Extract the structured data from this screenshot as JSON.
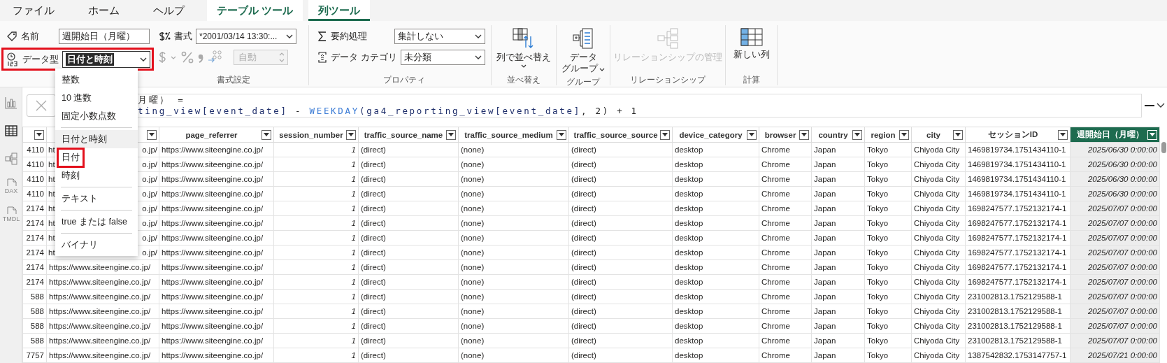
{
  "tabs": [
    {
      "label": "ファイル",
      "kind": "main",
      "selected": false
    },
    {
      "label": "ホーム",
      "kind": "main",
      "selected": false
    },
    {
      "label": "ヘルプ",
      "kind": "main",
      "selected": false
    },
    {
      "label": "テーブル ツール",
      "kind": "context",
      "selected": false
    },
    {
      "label": "列ツール",
      "kind": "context",
      "selected": true
    }
  ],
  "structure": {
    "name_label": "名前",
    "name_value": "週開始日（月曜）",
    "type_label": "データ型",
    "type_value": "日付と時刻",
    "type_value_selected": true,
    "type_marked": true
  },
  "formatting": {
    "format_label": "書式",
    "format_value": "*2001/03/14 13:30:...",
    "decimals_value": "自動",
    "decimals_disabled": true,
    "group_label": "書式設定"
  },
  "properties": {
    "summary_label": "要約処理",
    "summary_value": "集計しない",
    "category_label": "データ カテゴリ",
    "category_value": "未分類",
    "group_label": "プロパティ"
  },
  "command_groups": [
    {
      "label": "並べ替え",
      "button": {
        "label": "列で並べ替え",
        "disabled": false
      }
    },
    {
      "label": "グループ",
      "button": {
        "label_lines": [
          "データ",
          "グループ"
        ],
        "disabled": false
      }
    },
    {
      "label": "リレーションシップ",
      "button": {
        "label": "リレーションシップの管理",
        "disabled": true
      }
    },
    {
      "label": "計算",
      "button": {
        "label": "新しい列",
        "disabled": false
      }
    }
  ],
  "type_menu": [
    [
      {
        "label": "整数",
        "selected": false,
        "marked": false
      },
      {
        "label": "10 進数",
        "selected": false,
        "marked": false
      },
      {
        "label": "固定小数点数",
        "selected": false,
        "marked": false
      }
    ],
    [
      {
        "label": "日付と時刻",
        "selected": true,
        "marked": false
      },
      {
        "label": "日付",
        "selected": false,
        "marked": true
      },
      {
        "label": "時刻",
        "selected": false,
        "marked": false
      }
    ],
    [
      {
        "label": "テキスト",
        "selected": false,
        "marked": false
      }
    ],
    [
      {
        "label": "true または false",
        "selected": false,
        "marked": false
      }
    ],
    [
      {
        "label": "バイナリ",
        "selected": false,
        "marked": false
      }
    ]
  ],
  "views": [
    {
      "selected": false
    },
    {
      "selected": true
    },
    {
      "selected": false
    },
    {
      "label": "DAX",
      "selected": false
    },
    {
      "label": "TMDL",
      "selected": false
    }
  ],
  "formula": {
    "line_1": "月曜） =",
    "line_2": [
      {
        "text": "ting_view[event_date]",
        "kind": "column"
      },
      {
        "text": " - ",
        "kind": "operator"
      },
      {
        "text": "WEEKDAY",
        "kind": "function"
      },
      {
        "text": "(ga4_reporting_view[event_date]",
        "kind": "column"
      },
      {
        "text": ", 2) + 1",
        "kind": "operator"
      }
    ]
  },
  "table": {
    "columns": [
      {
        "selected": false
      },
      {
        "selected": false
      },
      {
        "name": "page_referrer",
        "selected": false
      },
      {
        "name": "session_number",
        "selected": false
      },
      {
        "name": "traffic_source_name",
        "selected": false
      },
      {
        "name": "traffic_source_medium",
        "selected": false
      },
      {
        "name": "traffic_source_source",
        "selected": false
      },
      {
        "name": "device_category",
        "selected": false
      },
      {
        "name": "browser",
        "selected": false
      },
      {
        "name": "country",
        "selected": false
      },
      {
        "name": "region",
        "selected": false
      },
      {
        "name": "city",
        "selected": false
      },
      {
        "name": "セッションID",
        "selected": false
      },
      {
        "name": "週開始日（月曜）",
        "selected": true
      }
    ],
    "rows": [
      [
        "4110",
        {
          "start": "ht",
          "end": "o.jp/"
        },
        "https://www.siteengine.co.jp/",
        "1",
        "(direct)",
        "(none)",
        "(direct)",
        "desktop",
        "Chrome",
        "Japan",
        "Tokyo",
        "Chiyoda City",
        "1469819734.1751434110-1",
        "2025/06/30 0:00:00"
      ],
      [
        "4110",
        {
          "start": "ht",
          "end": "o.jp/"
        },
        "https://www.siteengine.co.jp/",
        "1",
        "(direct)",
        "(none)",
        "(direct)",
        "desktop",
        "Chrome",
        "Japan",
        "Tokyo",
        "Chiyoda City",
        "1469819734.1751434110-1",
        "2025/06/30 0:00:00"
      ],
      [
        "4110",
        {
          "start": "ht",
          "end": "o.jp/"
        },
        "https://www.siteengine.co.jp/",
        "1",
        "(direct)",
        "(none)",
        "(direct)",
        "desktop",
        "Chrome",
        "Japan",
        "Tokyo",
        "Chiyoda City",
        "1469819734.1751434110-1",
        "2025/06/30 0:00:00"
      ],
      [
        "4110",
        {
          "start": "ht",
          "end": "o.jp/"
        },
        "https://www.siteengine.co.jp/",
        "1",
        "(direct)",
        "(none)",
        "(direct)",
        "desktop",
        "Chrome",
        "Japan",
        "Tokyo",
        "Chiyoda City",
        "1469819734.1751434110-1",
        "2025/06/30 0:00:00"
      ],
      [
        "2174",
        {
          "start": "ht",
          "end": "o.jp/"
        },
        "https://www.siteengine.co.jp/",
        "1",
        "(direct)",
        "(none)",
        "(direct)",
        "desktop",
        "Chrome",
        "Japan",
        "Tokyo",
        "Chiyoda City",
        "1698247577.1752132174-1",
        "2025/07/07 0:00:00"
      ],
      [
        "2174",
        {
          "start": "ht",
          "end": "o.jp/"
        },
        "https://www.siteengine.co.jp/",
        "1",
        "(direct)",
        "(none)",
        "(direct)",
        "desktop",
        "Chrome",
        "Japan",
        "Tokyo",
        "Chiyoda City",
        "1698247577.1752132174-1",
        "2025/07/07 0:00:00"
      ],
      [
        "2174",
        {
          "start": "ht",
          "end": "o.jp/"
        },
        "https://www.siteengine.co.jp/",
        "1",
        "(direct)",
        "(none)",
        "(direct)",
        "desktop",
        "Chrome",
        "Japan",
        "Tokyo",
        "Chiyoda City",
        "1698247577.1752132174-1",
        "2025/07/07 0:00:00"
      ],
      [
        "2174",
        {
          "start": "ht",
          "end": "o.jp/"
        },
        "https://www.siteengine.co.jp/",
        "1",
        "(direct)",
        "(none)",
        "(direct)",
        "desktop",
        "Chrome",
        "Japan",
        "Tokyo",
        "Chiyoda City",
        "1698247577.1752132174-1",
        "2025/07/07 0:00:00"
      ],
      [
        "2174",
        "https://www.siteengine.co.jp/",
        "https://www.siteengine.co.jp/",
        "1",
        "(direct)",
        "(none)",
        "(direct)",
        "desktop",
        "Chrome",
        "Japan",
        "Tokyo",
        "Chiyoda City",
        "1698247577.1752132174-1",
        "2025/07/07 0:00:00"
      ],
      [
        "2174",
        "https://www.siteengine.co.jp/",
        "https://www.siteengine.co.jp/",
        "1",
        "(direct)",
        "(none)",
        "(direct)",
        "desktop",
        "Chrome",
        "Japan",
        "Tokyo",
        "Chiyoda City",
        "1698247577.1752132174-1",
        "2025/07/07 0:00:00"
      ],
      [
        "588",
        "https://www.siteengine.co.jp/",
        "https://www.siteengine.co.jp/",
        "1",
        "(direct)",
        "(none)",
        "(direct)",
        "desktop",
        "Chrome",
        "Japan",
        "Tokyo",
        "Chiyoda City",
        "231002813.1752129588-1",
        "2025/07/07 0:00:00"
      ],
      [
        "588",
        "https://www.siteengine.co.jp/",
        "https://www.siteengine.co.jp/",
        "1",
        "(direct)",
        "(none)",
        "(direct)",
        "desktop",
        "Chrome",
        "Japan",
        "Tokyo",
        "Chiyoda City",
        "231002813.1752129588-1",
        "2025/07/07 0:00:00"
      ],
      [
        "588",
        "https://www.siteengine.co.jp/",
        "https://www.siteengine.co.jp/",
        "1",
        "(direct)",
        "(none)",
        "(direct)",
        "desktop",
        "Chrome",
        "Japan",
        "Tokyo",
        "Chiyoda City",
        "231002813.1752129588-1",
        "2025/07/07 0:00:00"
      ],
      [
        "588",
        "https://www.siteengine.co.jp/",
        "https://www.siteengine.co.jp/",
        "1",
        "(direct)",
        "(none)",
        "(direct)",
        "desktop",
        "Chrome",
        "Japan",
        "Tokyo",
        "Chiyoda City",
        "231002813.1752129588-1",
        "2025/07/07 0:00:00"
      ],
      [
        "7757",
        "https://www.siteengine.co.jp/",
        "https://www.siteengine.co.jp/",
        "1",
        "(direct)",
        "(none)",
        "(direct)",
        "desktop",
        "Chrome",
        "Japan",
        "Tokyo",
        "Chiyoda City",
        "1387542832.1753147757-1",
        "2025/07/21 0:00:00"
      ]
    ]
  }
}
